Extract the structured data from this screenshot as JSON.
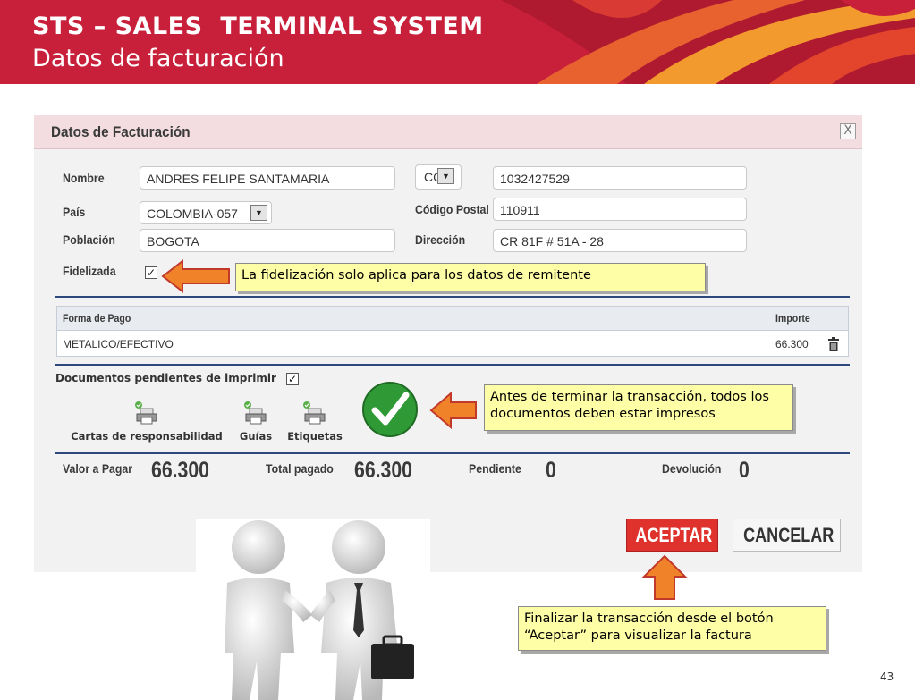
{
  "slide": {
    "title": "STS – SALES  TERMINAL SYSTEM",
    "subtitle": "Datos de facturación",
    "page_number": "43"
  },
  "dialog": {
    "title": "Datos de Facturación",
    "close_label": "X",
    "form": {
      "nombre_label": "Nombre",
      "nombre_value": "ANDRES FELIPE SANTAMARIA",
      "doc_type_value": "CC",
      "doc_number_value": "1032427529",
      "pais_label": "País",
      "pais_value": "COLOMBIA-057",
      "codigo_postal_label": "Código Postal",
      "codigo_postal_value": "110911",
      "poblacion_label": "Población",
      "poblacion_value": "BOGOTA",
      "direccion_label": "Dirección",
      "direccion_value": "CR 81F # 51A - 28",
      "fidelizada_label": "Fidelizada",
      "fidelizada_checked": true
    },
    "payment_table": {
      "headers": [
        "Forma de Pago",
        "Importe"
      ],
      "rows": [
        {
          "forma": "METALICO/EFECTIVO",
          "importe": "66.300"
        }
      ]
    },
    "documents": {
      "label": "Documentos pendientes de imprimir",
      "checked": true,
      "items": [
        "Cartas de responsabilidad",
        "Guías",
        "Etiquetas"
      ]
    },
    "summary": {
      "valor_label": "Valor a Pagar",
      "valor_value": "66.300",
      "total_label": "Total pagado",
      "total_value": "66.300",
      "pendiente_label": "Pendiente",
      "pendiente_value": "0",
      "devolucion_label": "Devolución",
      "devolucion_value": "0"
    },
    "buttons": {
      "accept": "ACEPTAR",
      "cancel": "CANCELAR"
    }
  },
  "callouts": {
    "fidelizacion": "La fidelización solo aplica para los datos de remitente",
    "documentos": "Antes de terminar la transacción, todos los documentos deben estar impresos",
    "finalizar": "Finalizar la transacción desde el botón “Aceptar” para visualizar la factura"
  },
  "colors": {
    "header_red": "#c8203a",
    "accent_orange": "#f0822a",
    "callout_yellow": "#fefea6",
    "accept_red": "#e0322c",
    "check_green": "#2f9a35"
  }
}
